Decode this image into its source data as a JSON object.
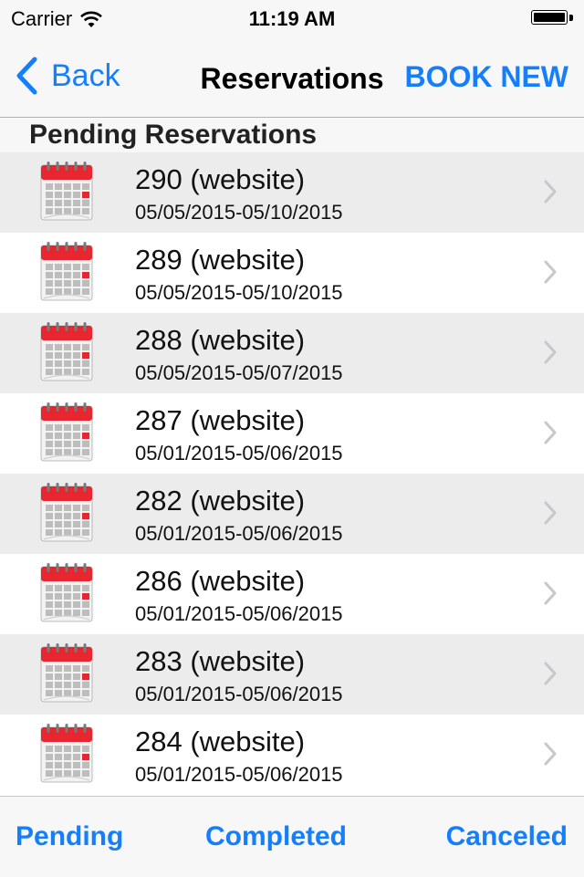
{
  "status_bar": {
    "carrier": "Carrier",
    "time": "11:19 AM"
  },
  "nav": {
    "back_label": "Back",
    "title": "Reservations",
    "book_new_label": "BOOK NEW"
  },
  "section": {
    "title": "Pending Reservations"
  },
  "reservations": [
    {
      "title": "290 (website)",
      "dates": "05/05/2015-05/10/2015"
    },
    {
      "title": "289 (website)",
      "dates": "05/05/2015-05/10/2015"
    },
    {
      "title": "288 (website)",
      "dates": "05/05/2015-05/07/2015"
    },
    {
      "title": "287 (website)",
      "dates": "05/01/2015-05/06/2015"
    },
    {
      "title": "282 (website)",
      "dates": "05/01/2015-05/06/2015"
    },
    {
      "title": "286 (website)",
      "dates": "05/01/2015-05/06/2015"
    },
    {
      "title": "283 (website)",
      "dates": "05/01/2015-05/06/2015"
    },
    {
      "title": "284 (website)",
      "dates": "05/01/2015-05/06/2015"
    }
  ],
  "tabs": [
    {
      "label": "Pending"
    },
    {
      "label": "Completed"
    },
    {
      "label": "Canceled"
    }
  ],
  "icons": {
    "row_icon": "calendar-icon",
    "row_accessory": "chevron-right-icon"
  },
  "colors": {
    "accent": "#157efb",
    "calendar_red": "#e8262f",
    "row_alt": "#ececec"
  }
}
